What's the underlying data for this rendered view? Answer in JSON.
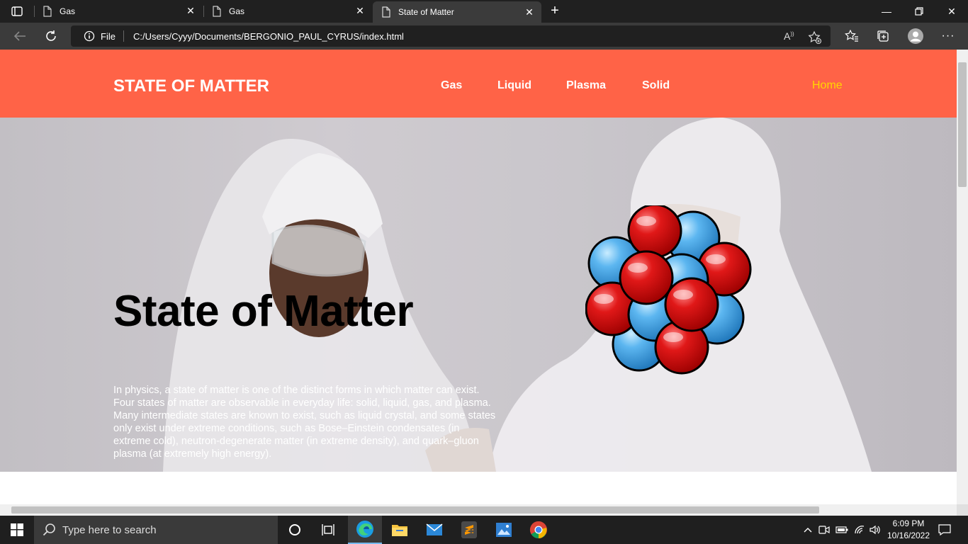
{
  "browser": {
    "tabs": [
      {
        "title": "Gas",
        "active": false
      },
      {
        "title": "Gas",
        "active": false
      },
      {
        "title": "State of Matter",
        "active": true
      }
    ],
    "address": {
      "scheme_label": "File",
      "url": "C:/Users/Cyyy/Documents/BERGONIO_PAUL_CYRUS/index.html"
    }
  },
  "page": {
    "brand": "STATE OF MATTER",
    "nav": [
      "Gas",
      "Liquid",
      "Plasma",
      "Solid"
    ],
    "home": "Home",
    "hero_title": "State of Matter",
    "hero_text": "In physics, a state of matter is one of the distinct forms in which matter can exist. Four states of matter are observable in everyday life: solid, liquid, gas, and plasma. Many intermediate states are known to exist, such as liquid crystal, and some states only exist under extreme conditions, such as Bose–Einstein condensates (in extreme cold), neutron-degenerate matter (in extreme density), and quark–gluon plasma (at extremely high energy).",
    "colors": {
      "header": "#ff6347",
      "home_link": "#ffd700",
      "proton": "#dd1111",
      "neutron": "#4aa8ea"
    }
  },
  "taskbar": {
    "search_placeholder": "Type here to search",
    "time": "6:09 PM",
    "date": "10/16/2022"
  }
}
